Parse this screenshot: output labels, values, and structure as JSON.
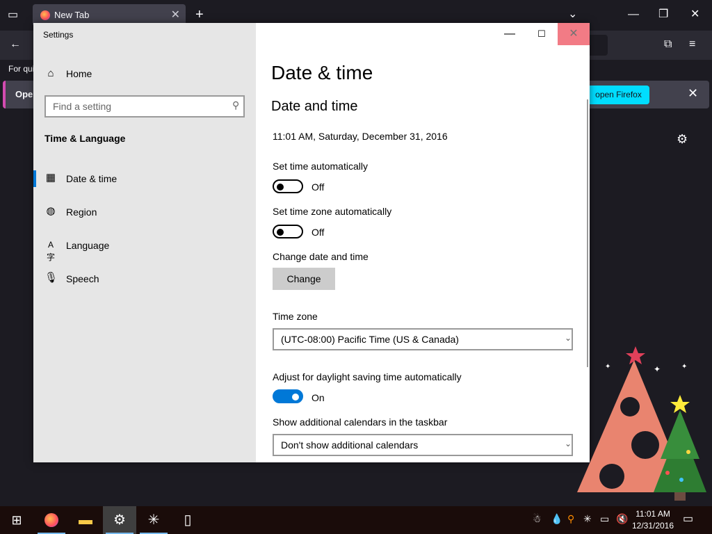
{
  "firefox": {
    "tab_title": "New Tab",
    "tab_close": "✕",
    "new_tab": "+",
    "bookmarks_text": "For qui",
    "notice_label": "Open",
    "notice_button": "open Firefox",
    "notice_close": "✕"
  },
  "settings": {
    "window_title": "Settings",
    "nav": {
      "home": "Home",
      "search_placeholder": "Find a setting",
      "section": "Time & Language",
      "items": [
        {
          "label": "Date & time",
          "icon": "calendar-clock-icon",
          "active": true
        },
        {
          "label": "Region",
          "icon": "globe-icon",
          "active": false
        },
        {
          "label": "Language",
          "icon": "language-icon",
          "active": false
        },
        {
          "label": "Speech",
          "icon": "microphone-icon",
          "active": false
        }
      ]
    },
    "main": {
      "page_title": "Date & time",
      "sub_title": "Date and time",
      "current_datetime": "11:01 AM, Saturday, December 31, 2016",
      "set_time_auto": {
        "label": "Set time automatically",
        "state": "Off"
      },
      "set_tz_auto": {
        "label": "Set time zone automatically",
        "state": "Off"
      },
      "change_label": "Change date and time",
      "change_button": "Change",
      "timezone_label": "Time zone",
      "timezone_value": "(UTC-08:00) Pacific Time (US & Canada)",
      "dst_label": "Adjust for daylight saving time automatically",
      "dst_state": "On",
      "calendars_label": "Show additional calendars in the taskbar",
      "calendars_value": "Don't show additional calendars"
    }
  },
  "taskbar": {
    "clock_time": "11:01 AM",
    "clock_date": "12/31/2016"
  },
  "colors": {
    "accent": "#0078d7",
    "firefox_cyan": "#00ddff",
    "close_hover": "#e81123"
  }
}
